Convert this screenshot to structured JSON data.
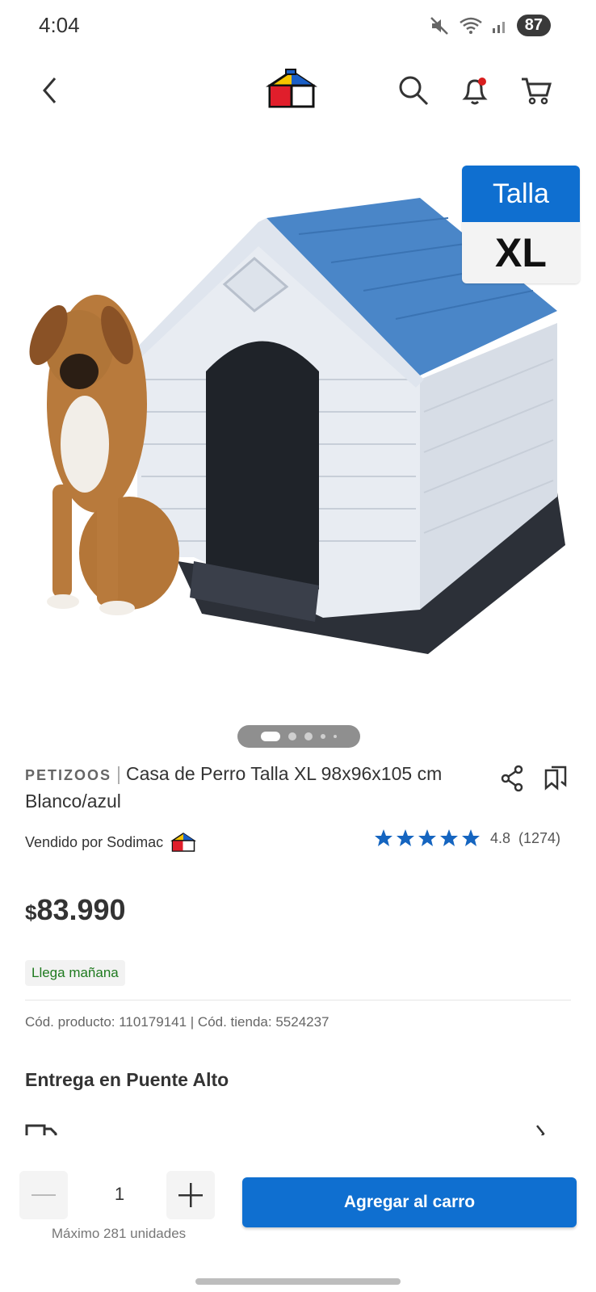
{
  "status_bar": {
    "time": "4:04",
    "battery": "87"
  },
  "header": {
    "back_icon": "chevron-left-icon",
    "logo": "sodimac-house-logo",
    "search_icon": "search-icon",
    "bell_icon": "bell-icon",
    "cart_icon": "cart-icon"
  },
  "product": {
    "size_badge": {
      "label": "Talla",
      "value": "XL"
    },
    "image_pager": {
      "count": 5,
      "active": 0
    },
    "brand": "PETIZOOS",
    "name": "Casa de Perro Talla XL 98x96x105 cm Blanco/azul",
    "seller": "Vendido por Sodimac",
    "rating": {
      "stars": 5,
      "value": "4.8",
      "count": "(1274)"
    },
    "price": {
      "currency": "$",
      "amount": "83.990"
    },
    "delivery_tag": "Llega mañana",
    "codes": "Cód. producto: 110179141 | Cód. tienda: 5524237"
  },
  "delivery": {
    "title": "Entrega en Puente Alto"
  },
  "cart_bar": {
    "quantity": "1",
    "max": "Máximo 281 unidades",
    "add_label": "Agregar al carro"
  },
  "colors": {
    "brand_blue": "#0f6fd0",
    "star_blue": "#1565c0",
    "green": "#1f7a1f"
  }
}
